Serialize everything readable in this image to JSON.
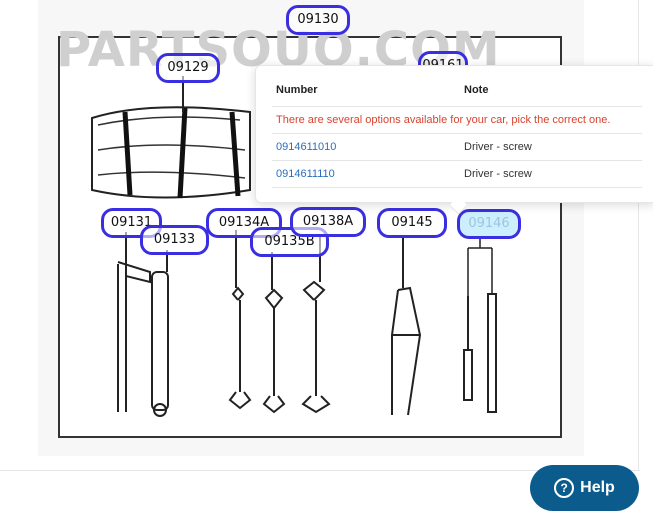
{
  "watermark": "PARTSOUQ.COM",
  "callouts": {
    "c09130": "09130",
    "c09129": "09129",
    "c09161": "09161",
    "c09131": "09131",
    "c09133": "09133",
    "c09134a": "09134A",
    "c09135b": "09135B",
    "c09138a": "09138A",
    "c09145": "09145",
    "c09146": "09146"
  },
  "popover": {
    "headers": {
      "number": "Number",
      "note": "Note"
    },
    "warning": "There are several options available for your car, pick the correct one.",
    "rows": [
      {
        "number": "0914611010",
        "note": "Driver - screw"
      },
      {
        "number": "0914611110",
        "note": "Driver - screw"
      }
    ]
  },
  "help": {
    "label": "Help",
    "icon": "question-circle-icon"
  },
  "colors": {
    "callout_border": "#3a2fe0",
    "active_callout_bg": "#cdeefc",
    "warning_text": "#d9432f",
    "link": "#2a6ebb",
    "help_bg": "#0b5c8c"
  }
}
